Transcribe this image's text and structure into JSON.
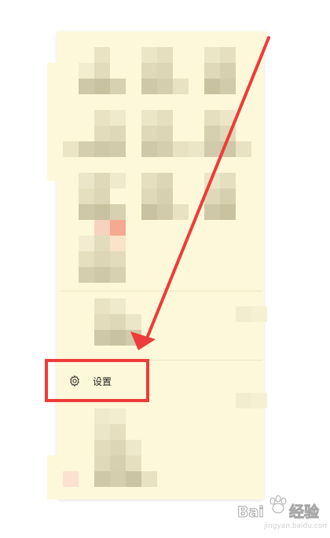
{
  "menu": {
    "settings_label": "设置",
    "settings_icon": "gear-icon"
  },
  "watermark": {
    "brand": "Bai",
    "brand_cn": "经验",
    "url": "jingyan.baidu.com"
  },
  "colors": {
    "panel_bg": "#fef8da",
    "highlight": "#ee3b3b",
    "arrow": "#ee3b3b"
  }
}
